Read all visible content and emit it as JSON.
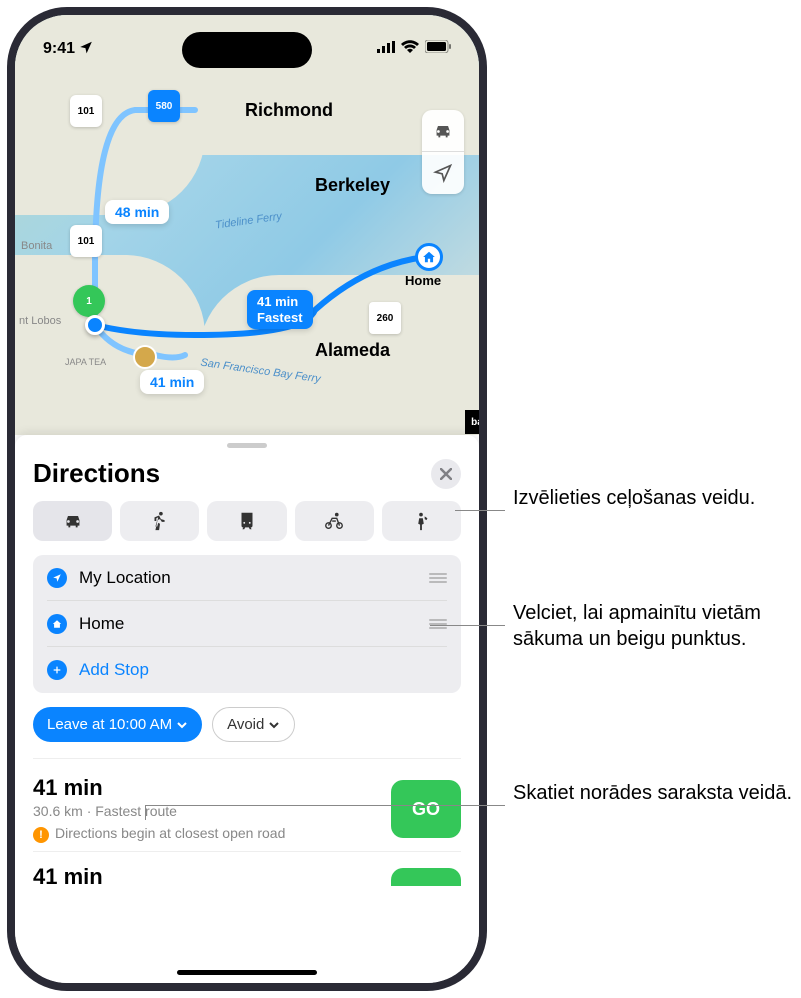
{
  "status": {
    "time": "9:41",
    "location_arrow": "↗"
  },
  "map": {
    "cities": {
      "richmond": "Richmond",
      "berkeley": "Berkeley",
      "alameda": "Alameda"
    },
    "ferries": {
      "tideline": "Tideline Ferry",
      "sfbay": "San Francisco Bay Ferry"
    },
    "small_text": {
      "bonita": "Bonita",
      "lobos": "nt Lobos",
      "japa_tea": "JAPA\nTEA"
    },
    "shields": {
      "hw101a": "101",
      "hw101b": "101",
      "i580": "580",
      "hw1": "1",
      "i260": "260"
    },
    "badges": {
      "alt1": "48 min",
      "alt2": "41 min",
      "primary_time": "41 min",
      "primary_sub": "Fastest"
    },
    "home_label": "Home"
  },
  "sheet": {
    "title": "Directions",
    "waypoints": {
      "start": "My Location",
      "end": "Home",
      "add": "Add Stop"
    },
    "options": {
      "leave": "Leave at 10:00 AM",
      "avoid": "Avoid"
    },
    "routes": [
      {
        "time": "41 min",
        "sub": "30.6 km · Fastest route",
        "note": "Directions begin at closest open road",
        "go": "GO"
      },
      {
        "time": "41 min"
      }
    ]
  },
  "callouts": {
    "transport": "Izvēlieties ceļošanas veidu.",
    "drag": "Velciet, lai apmainītu vietām sākuma un beigu punktus.",
    "list": "Skatiet norādes saraksta veidā."
  }
}
